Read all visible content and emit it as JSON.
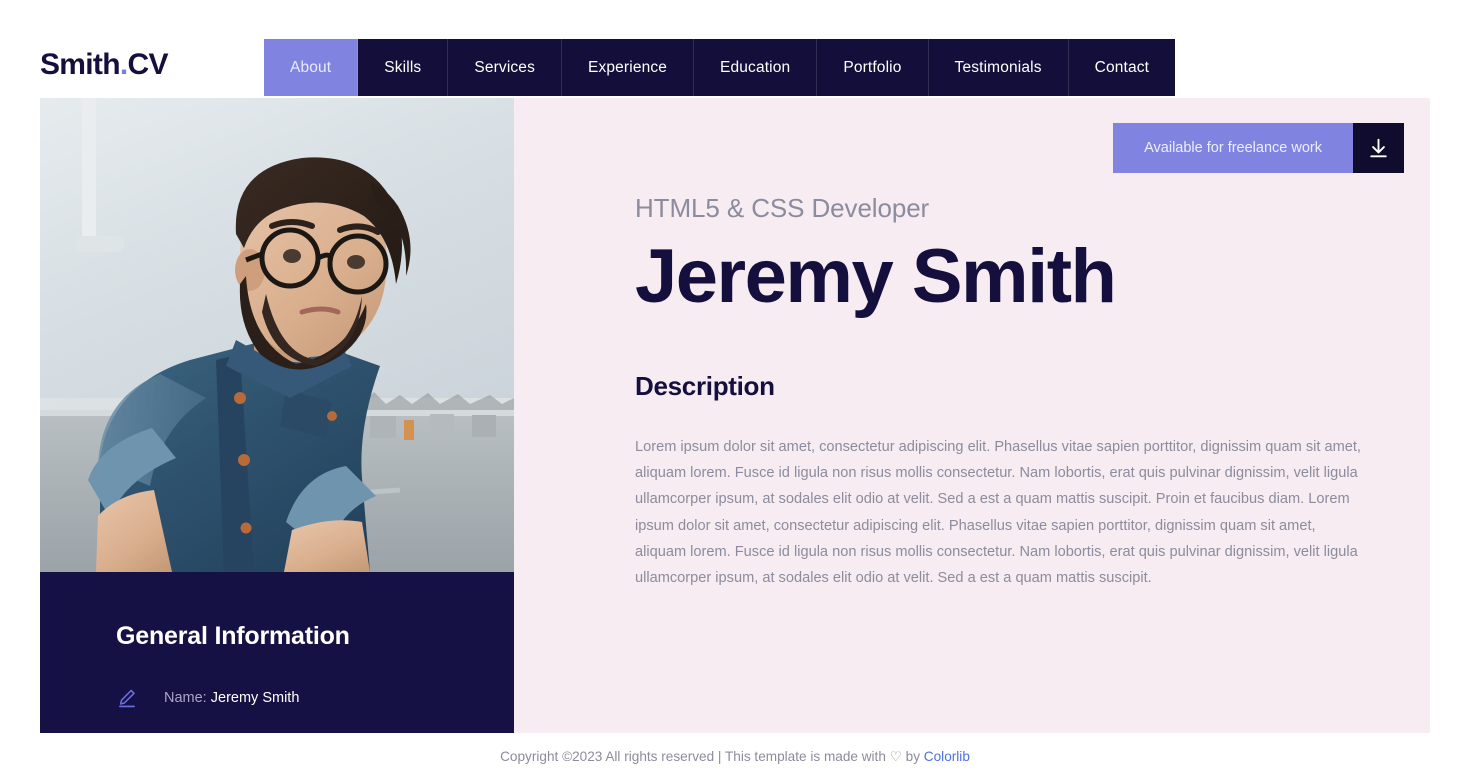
{
  "header": {
    "logo_main": "Smith",
    "logo_dot": ".",
    "logo_accent": "CV",
    "nav": [
      {
        "label": "About",
        "active": true
      },
      {
        "label": "Skills",
        "active": false
      },
      {
        "label": "Services",
        "active": false
      },
      {
        "label": "Experience",
        "active": false
      },
      {
        "label": "Education",
        "active": false
      },
      {
        "label": "Portfolio",
        "active": false
      },
      {
        "label": "Testimonials",
        "active": false
      },
      {
        "label": "Contact",
        "active": false
      }
    ]
  },
  "hero": {
    "badge_label": "Available for freelance work",
    "download_icon": "download-icon",
    "subtitle": "HTML5 & CSS Developer",
    "name": "Jeremy Smith",
    "section_title": "Description",
    "description": "Lorem ipsum dolor sit amet, consectetur adipiscing elit. Phasellus vitae sapien porttitor, dignissim quam sit amet, aliquam lorem. Fusce id ligula non risus mollis consectetur. Nam lobortis, erat quis pulvinar dignissim, velit ligula ullamcorper ipsum, at sodales elit odio at velit. Sed a est a quam mattis suscipit. Proin et faucibus diam. Lorem ipsum dolor sit amet, consectetur adipiscing elit. Phasellus vitae sapien porttitor, dignissim quam sit amet, aliquam lorem. Fusce id ligula non risus mollis consectetur. Nam lobortis, erat quis pulvinar dignissim, velit ligula ullamcorper ipsum, at sodales elit odio at velit. Sed a est a quam mattis suscipit."
  },
  "profile": {
    "photo_alt": "profile-photo-bearded-man-denim-shirt",
    "info_title": "General Information",
    "rows": [
      {
        "icon": "pencil-icon",
        "label": "Name:",
        "value": "Jeremy Smith"
      }
    ]
  },
  "footer": {
    "copyright_prefix": "Copyright ©2023 All rights reserved | This template is made with",
    "heart": "♡",
    "by": "by",
    "link": "Colorlib"
  },
  "colors": {
    "accent_purple": "#8084e0",
    "navy": "#140f3a",
    "card_navy": "#161145",
    "panel_pink": "#f6ecf1",
    "muted_text": "#8c8c9e",
    "link_blue": "#4d72e3"
  }
}
